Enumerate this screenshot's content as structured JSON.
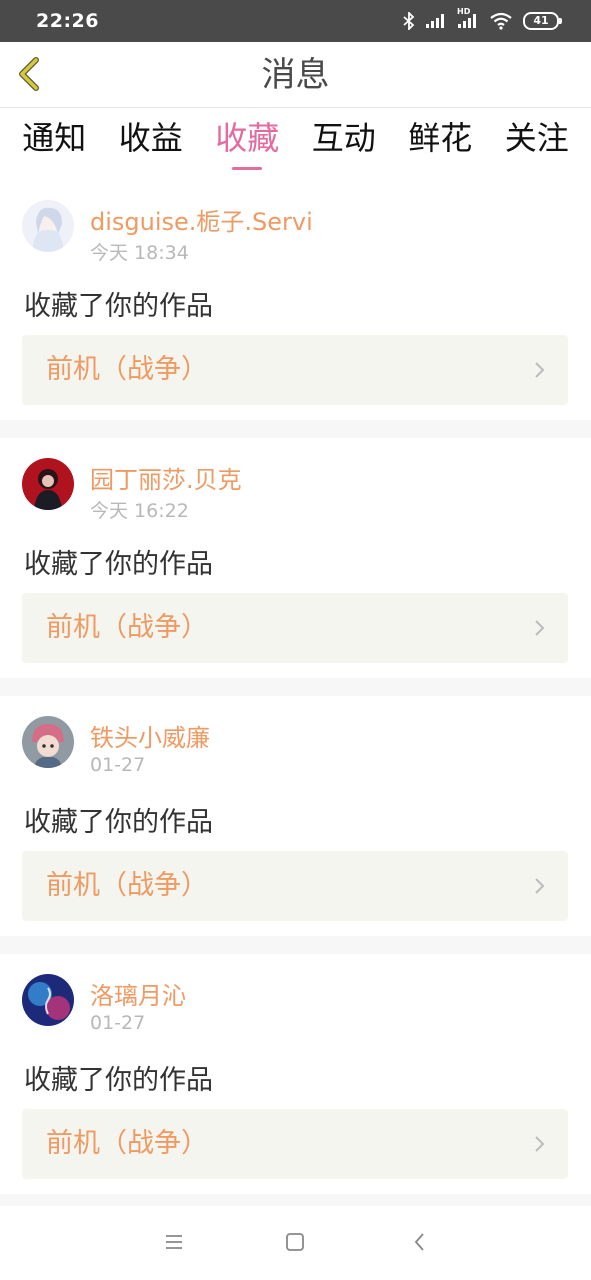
{
  "status_bar": {
    "time": "22:26",
    "battery": "41",
    "hd_label": "HD"
  },
  "header": {
    "title": "消息"
  },
  "tabs": [
    {
      "label": "通知",
      "active": false
    },
    {
      "label": "收益",
      "active": false
    },
    {
      "label": "收藏",
      "active": true
    },
    {
      "label": "互动",
      "active": false
    },
    {
      "label": "鲜花",
      "active": false
    },
    {
      "label": "关注",
      "active": false
    }
  ],
  "messages": [
    {
      "username": "disguise.栀子.Servi",
      "time": "今天 18:34",
      "action": "收藏了你的作品",
      "work": "前机（战争）"
    },
    {
      "username": "园丁丽莎.贝克",
      "time": "今天 16:22",
      "action": "收藏了你的作品",
      "work": "前机（战争）"
    },
    {
      "username": "铁头小威廉",
      "time": "01-27",
      "action": "收藏了你的作品",
      "work": "前机（战争）"
    },
    {
      "username": "洛璃月沁",
      "time": "01-27",
      "action": "收藏了你的作品",
      "work": "前机（战争）"
    }
  ],
  "colors": {
    "accent": "#e56aa0",
    "username": "#ef9a62",
    "status_bar": "#4a4a4a",
    "back_arrow": "#d7c93a"
  }
}
